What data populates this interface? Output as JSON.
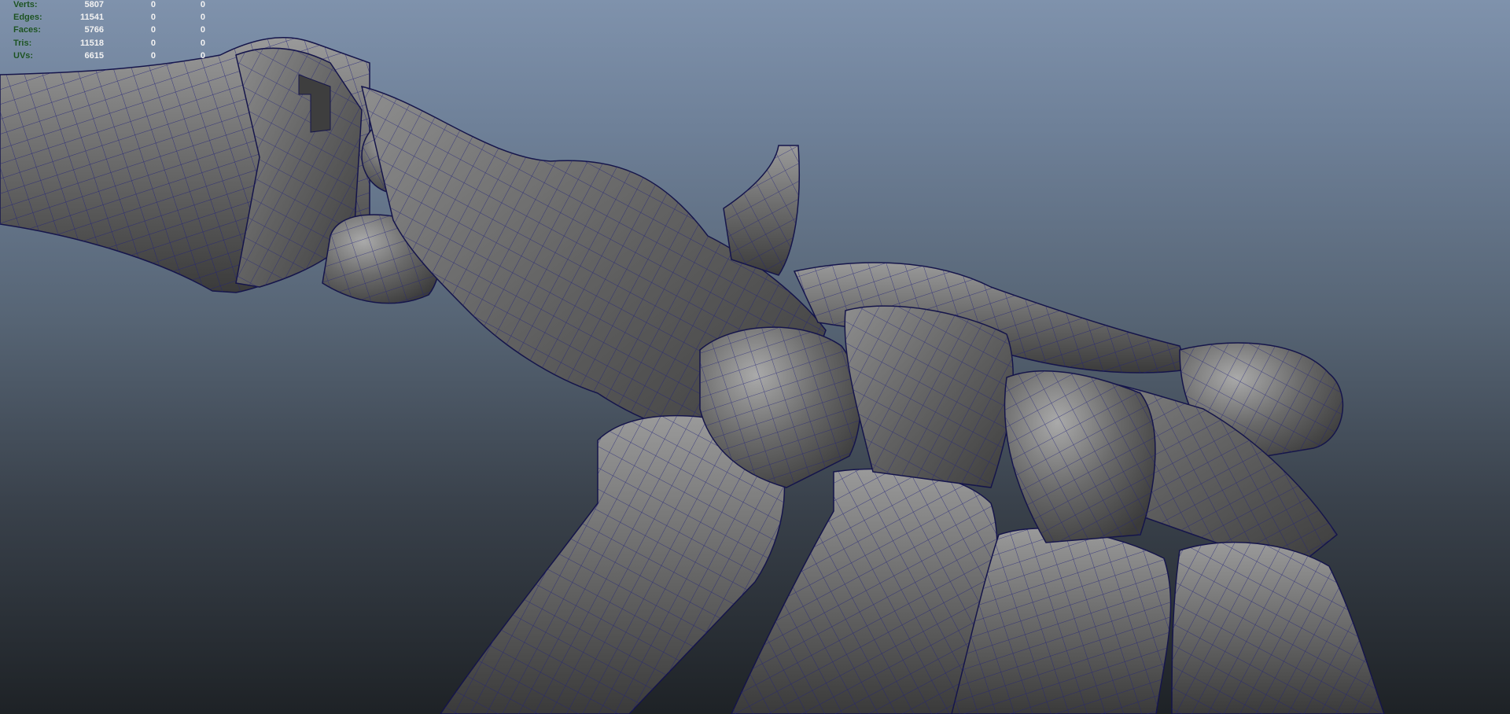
{
  "hud": {
    "rows": [
      {
        "label": "Verts:",
        "value": "5807",
        "selected": "0",
        "component": "0"
      },
      {
        "label": "Edges:",
        "value": "11541",
        "selected": "0",
        "component": "0"
      },
      {
        "label": "Faces:",
        "value": "5766",
        "selected": "0",
        "component": "0"
      },
      {
        "label": "Tris:",
        "value": "11518",
        "selected": "0",
        "component": "0"
      },
      {
        "label": "UVs:",
        "value": "6615",
        "selected": "0",
        "component": "0"
      }
    ]
  },
  "colors": {
    "hud_label": "#1b4f22",
    "hud_value": "#f2f2f2",
    "wireframe": "#23237a",
    "mesh_shade": "#6c6c6c",
    "background_top": "#7f92ac",
    "background_bottom": "#1e2226"
  }
}
